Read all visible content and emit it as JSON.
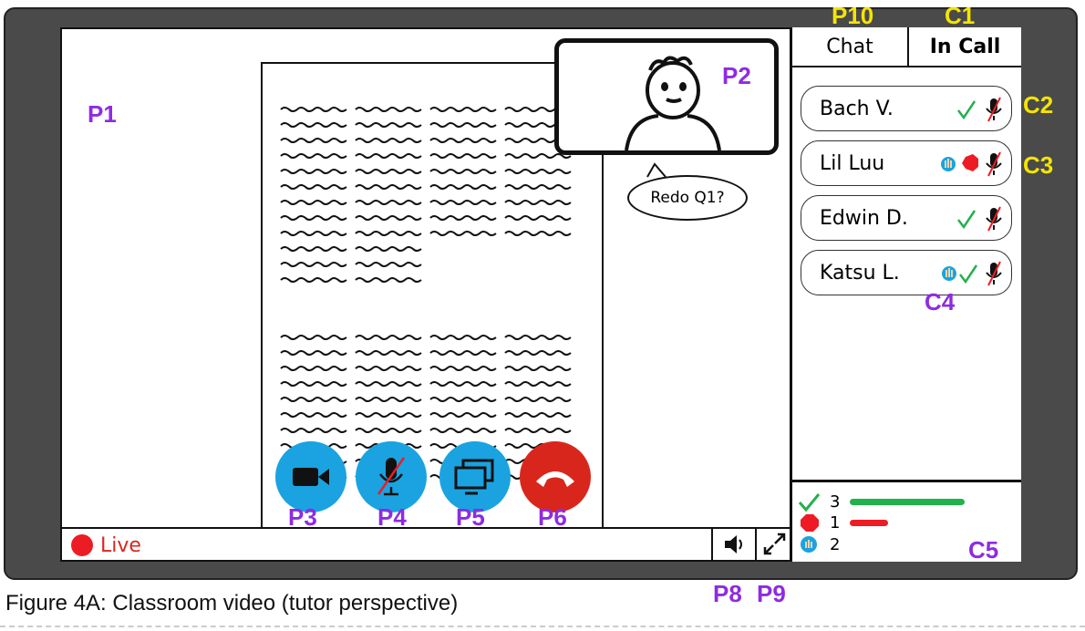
{
  "caption": "Figure 4A: Classroom video (tutor perspective)",
  "labels": {
    "p1": "P1",
    "p2": "P2",
    "p3": "P3",
    "p4": "P4",
    "p5": "P5",
    "p6": "P6",
    "p8": "P8",
    "p9": "P9",
    "p10": "P10",
    "c1": "C1",
    "c2": "C2",
    "c3": "C3",
    "c4": "C4",
    "c5": "C5"
  },
  "speech_bubble": "Redo Q1?",
  "tabs": {
    "chat": "Chat",
    "in_call": "In Call"
  },
  "live_label": "Live",
  "participants": [
    {
      "name": "Bach V.",
      "status": [
        "check"
      ],
      "mic": "muted"
    },
    {
      "name": "Lil Luu",
      "status": [
        "hand",
        "stop"
      ],
      "mic": "muted"
    },
    {
      "name": "Edwin D.",
      "status": [
        "check"
      ],
      "mic": "muted"
    },
    {
      "name": "Katsu L.",
      "status": [
        "hand",
        "check"
      ],
      "mic": "muted"
    }
  ],
  "summary": {
    "check_count": "3",
    "stop_count": "1",
    "hand_count": "2",
    "check_fraction": 0.75,
    "stop_fraction": 0.25
  },
  "colors": {
    "blue_button": "#1aa3e0",
    "red_button": "#d9261c",
    "green": "#22b14c",
    "red": "#ed1c24",
    "purple_label": "#8e2be2",
    "yellow_label": "#f5e400"
  },
  "icons": {
    "camera": "video-camera-icon",
    "mic": "microphone-icon",
    "screen": "screen-share-icon",
    "hangup": "hang-up-icon",
    "volume": "volume-icon",
    "fullscreen": "fullscreen-icon"
  }
}
